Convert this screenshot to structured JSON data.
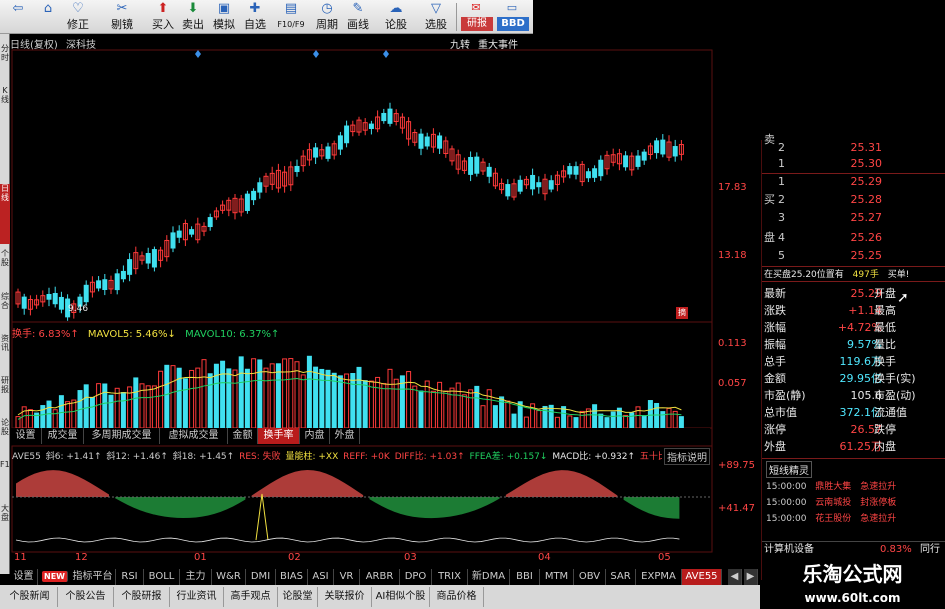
{
  "toolbar": {
    "buttons": [
      {
        "label": "",
        "icon": "arrow-left-icon"
      },
      {
        "label": "修正",
        "icon": "heart-icon"
      },
      {
        "label": "剔镜",
        "icon": "scissors-icon"
      },
      {
        "label": "买入",
        "icon": "buy-icon"
      },
      {
        "label": "卖出",
        "icon": "sell-icon"
      },
      {
        "label": "模拟",
        "icon": "monitor-icon"
      },
      {
        "label": "自选",
        "icon": "plus-icon"
      },
      {
        "label": "F10/F9",
        "icon": "document-icon"
      },
      {
        "label": "周期",
        "icon": "clock-icon"
      },
      {
        "label": "画线",
        "icon": "pencil-icon"
      },
      {
        "label": "论股",
        "icon": "chat-icon"
      },
      {
        "label": "选股",
        "icon": "filter-icon"
      }
    ],
    "right_buttons": [
      "研报",
      "BBD"
    ]
  },
  "left_rail": [
    "分时",
    "K线",
    "日线",
    "个股",
    "综合",
    "资讯",
    "研报",
    "论股",
    "F10",
    "大盘"
  ],
  "chart_header": {
    "period": "日线(复权)",
    "stock_name": "深科技",
    "right_items": [
      "九转",
      "重大事件"
    ]
  },
  "price_panel": {
    "ticks": [
      "17.83",
      "13.18"
    ],
    "low_label": "9.46",
    "badge": "摘"
  },
  "volume_panel": {
    "legend": [
      {
        "text": "换手: 6.83%↑",
        "color": "#ff4545"
      },
      {
        "text": "MAVOL5: 5.46%↓",
        "color": "#f0e040"
      },
      {
        "text": "MAVOL10: 6.37%↑",
        "color": "#20d060"
      }
    ],
    "ticks": [
      "0.113",
      "0.057"
    ]
  },
  "indicator_tabs": [
    "设置",
    "成交量",
    "多周期成交量",
    "虚拟成交量",
    "金额",
    "换手率",
    "内盘",
    "外盘"
  ],
  "indicator_active": "换手率",
  "ave_panel": {
    "legend": [
      {
        "text": "AVE55",
        "color": "#cccccc"
      },
      {
        "text": "斜6: +1.41↑",
        "color": "#cccccc"
      },
      {
        "text": "斜12: +1.46↑",
        "color": "#cccccc"
      },
      {
        "text": "斜18: +1.45↑",
        "color": "#cccccc"
      },
      {
        "text": "RES: 失败",
        "color": "#ff4545"
      },
      {
        "text": "量能柱: +XX",
        "color": "#f0e040"
      },
      {
        "text": "REFF: +0K",
        "color": "#ff4545"
      },
      {
        "text": "DIFF比: +1.03↑",
        "color": "#ff4545"
      },
      {
        "text": "FFEA差: +0.157↓",
        "color": "#20d060"
      },
      {
        "text": "MACD比: +0.932↑",
        "color": "#e8e8e8"
      },
      {
        "text": "五十比",
        "color": "#ff4545"
      }
    ],
    "help_button": "指标说明",
    "ticks": [
      "+89.75",
      "+41.47"
    ]
  },
  "x_axis": [
    "11",
    "12",
    "01",
    "02",
    "03",
    "04",
    "05"
  ],
  "indicator_bar": [
    "设置",
    "NEW",
    "指标平台",
    "RSI",
    "BOLL",
    "主力",
    "W&R",
    "DMI",
    "BIAS",
    "ASI",
    "VR",
    "ARBR",
    "DPO",
    "TRIX",
    "新DMA",
    "BBI",
    "MTM",
    "OBV",
    "SAR",
    "EXPMA",
    "AVE55"
  ],
  "indicator_bar_active": "AVE55",
  "news_tabs": [
    "个股新闻",
    "个股公告",
    "个股研报",
    "行业资讯",
    "高手观点",
    "论股堂",
    "关联报价",
    "AI相似个股",
    "商品价格"
  ],
  "order_book": {
    "side_labels": {
      "sell": "卖",
      "buy_top": "买",
      "buy_bottom": "盘"
    },
    "rows": [
      {
        "num": "2",
        "price": "25.31"
      },
      {
        "num": "1",
        "price": "25.30"
      },
      {
        "num": "1",
        "price": "25.29"
      },
      {
        "num": "2",
        "price": "25.28"
      },
      {
        "num": "3",
        "price": "25.27"
      },
      {
        "num": "4",
        "price": "25.26"
      },
      {
        "num": "5",
        "price": "25.25"
      }
    ],
    "notice": "在买盘25.20位置有",
    "notice_qty": "497手",
    "notice_action": "买单!"
  },
  "quote": [
    {
      "label": "最新",
      "value": "25.29",
      "label2": "开盘",
      "color": "red"
    },
    {
      "label": "涨跌",
      "value": "+1.14",
      "label2": "最高",
      "color": "red"
    },
    {
      "label": "涨幅",
      "value": "+4.72%",
      "label2": "最低",
      "color": "red"
    },
    {
      "label": "振幅",
      "value": "9.57%",
      "label2": "量比",
      "color": "cyan"
    },
    {
      "label": "总手",
      "value": "119.6万",
      "label2": "换手",
      "color": "cyan"
    },
    {
      "label": "金额",
      "value": "29.95亿",
      "label2": "换手(实)",
      "color": "cyan"
    },
    {
      "label": "市盈(静)",
      "value": "105.6",
      "label2": "市盈(动)",
      "color": "white"
    },
    {
      "label": "总市值",
      "value": "372.1亿",
      "label2": "流通值",
      "color": "cyan"
    },
    {
      "label": "涨停",
      "value": "26.57",
      "label2": "跌停",
      "color": "red"
    },
    {
      "label": "外盘",
      "value": "61.25万",
      "label2": "内盘",
      "color": "red"
    }
  ],
  "short_line": {
    "title": "短线精灵",
    "items": [
      {
        "time": "15:00:00",
        "name": "鼎胜大集",
        "event": "急速拉升"
      },
      {
        "time": "15:00:00",
        "name": "云南城投",
        "event": "封涨停板"
      },
      {
        "time": "15:00:00",
        "name": "花王股份",
        "event": "急速拉升"
      }
    ],
    "footer_label": "计算机设备",
    "footer_value": "0.83%",
    "footer_action": "同行"
  },
  "watermark": {
    "title": "乐淘公式网",
    "url": "www.60lt.com"
  }
}
